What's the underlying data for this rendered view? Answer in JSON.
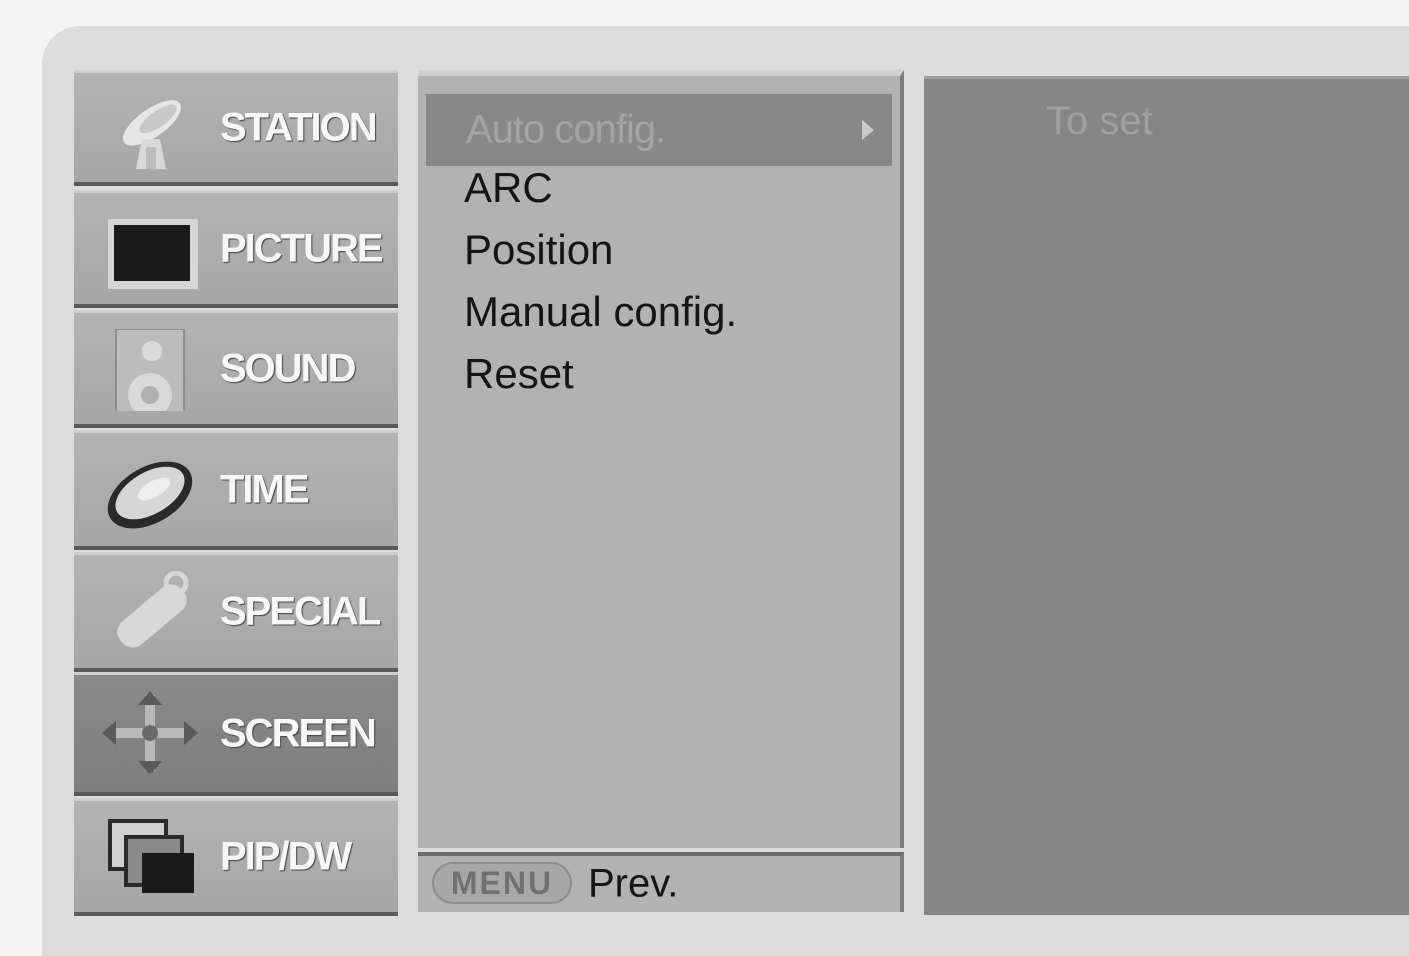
{
  "menu": {
    "items": [
      {
        "label": "STATION",
        "icon": "satellite-dish-icon",
        "active": false
      },
      {
        "label": "PICTURE",
        "icon": "monitor-icon",
        "active": false
      },
      {
        "label": "SOUND",
        "icon": "speaker-icon",
        "active": false
      },
      {
        "label": "TIME",
        "icon": "clock-icon",
        "active": false
      },
      {
        "label": "SPECIAL",
        "icon": "remote-tag-icon",
        "active": false
      },
      {
        "label": "SCREEN",
        "icon": "move-arrows-icon",
        "active": true
      },
      {
        "label": "PIP/DW",
        "icon": "pip-windows-icon",
        "active": false
      }
    ]
  },
  "submenu": {
    "selected": "Auto config.",
    "items": [
      "ARC",
      "Position",
      "Manual config.",
      "Reset"
    ],
    "footer": {
      "button_label": "MENU",
      "prev_label": "Prev."
    }
  },
  "right_panel": {
    "hint": "To set"
  },
  "colors": {
    "panel_bg": "#b2b2b2",
    "active_bg": "#888888",
    "right_bg": "#858585",
    "frame_bg": "#dcdcdc"
  }
}
